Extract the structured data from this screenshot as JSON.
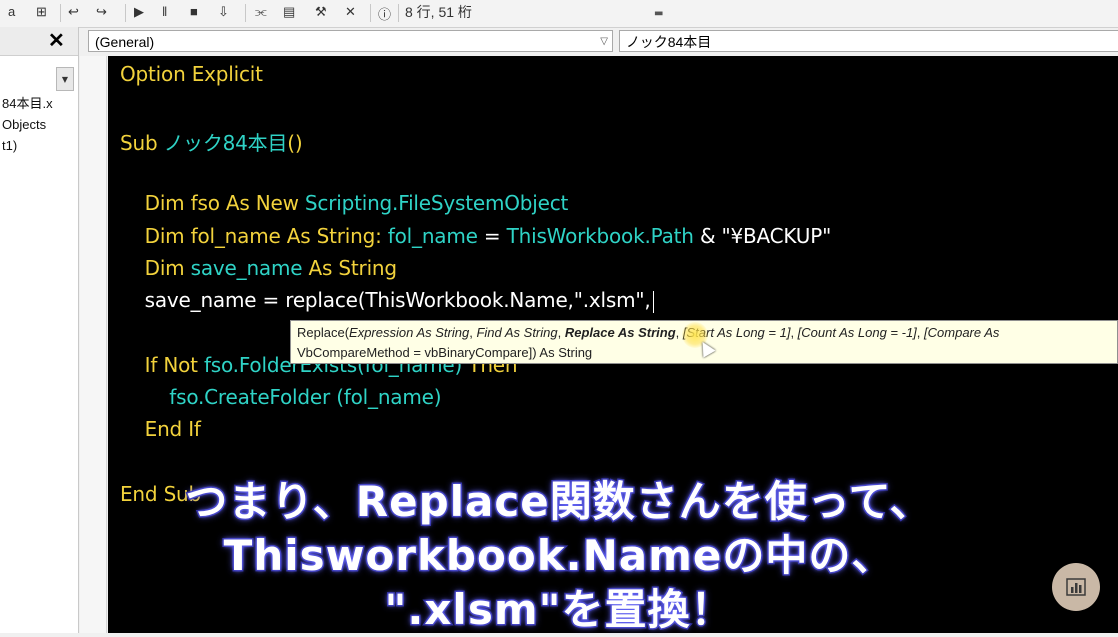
{
  "toolbar": {
    "items": [
      "a",
      "⊞",
      "↩",
      "↪",
      "▶",
      "‖",
      "■",
      "⇩",
      "⫘",
      "▤",
      "⚒",
      "✕",
      "ⓘ"
    ],
    "status": "8 行, 51 桁"
  },
  "project_panel": {
    "close_label": "✕",
    "tree": [
      "84本目.x",
      "Objects",
      "t1)"
    ]
  },
  "combos": {
    "object": "(General)",
    "procedure": "ノック84本目"
  },
  "code_lines": [
    {
      "tokens": [
        {
          "t": "Option Explicit",
          "c": "kw"
        }
      ]
    },
    {
      "tokens": []
    },
    {
      "tokens": [
        {
          "t": "Sub ",
          "c": "kw"
        },
        {
          "t": "ノック84本目",
          "c": "id"
        },
        {
          "t": "()",
          "c": "kw"
        }
      ]
    },
    {
      "tokens": []
    },
    {
      "tokens": [
        {
          "t": "    Dim fso As New ",
          "c": "kw"
        },
        {
          "t": "Scripting.FileSystemObject",
          "c": "id"
        }
      ]
    },
    {
      "tokens": [
        {
          "t": "    Dim fol_name As String: ",
          "c": "kw"
        },
        {
          "t": "fol_name",
          "c": "id"
        },
        {
          "t": " = ",
          "c": "tx"
        },
        {
          "t": "ThisWorkbook.Path",
          "c": "id"
        },
        {
          "t": " & \"¥BACKUP\"",
          "c": "tx"
        }
      ]
    },
    {
      "tokens": [
        {
          "t": "    Dim ",
          "c": "kw"
        },
        {
          "t": "save_name",
          "c": "id"
        },
        {
          "t": " As String",
          "c": "kw"
        }
      ]
    },
    {
      "tokens": [
        {
          "t": "    save_name = replace(ThisWorkbook.Name,\".xlsm\",",
          "c": "tx"
        }
      ],
      "cursor": true
    },
    {
      "tokens": []
    },
    {
      "tokens": [
        {
          "t": "    If Not ",
          "c": "kw"
        },
        {
          "t": "fso.FolderExists",
          "c": "id"
        },
        {
          "t": "(fol_name) ",
          "c": "id"
        },
        {
          "t": "Then",
          "c": "kw"
        }
      ]
    },
    {
      "tokens": [
        {
          "t": "        fso.CreateFolder ",
          "c": "id"
        },
        {
          "t": "(fol_name)",
          "c": "id"
        }
      ]
    },
    {
      "tokens": [
        {
          "t": "    End If",
          "c": "kw"
        }
      ]
    },
    {
      "tokens": []
    },
    {
      "tokens": [
        {
          "t": "End Sub",
          "c": "kw"
        }
      ]
    }
  ],
  "tooltip": {
    "fn": "Replace(",
    "p1": "Expression As String",
    "p2": "Find As String",
    "p3": "Replace As String",
    "p4": "[Start As Long = 1]",
    "p5": "[Count As Long = -1]",
    "p6": "[Compare As",
    "line2": "VbCompareMethod = vbBinaryCompare]) As String"
  },
  "caption": {
    "line1": "つまり、Replace関数さんを使って、",
    "line2": "Thisworkbook.Nameの中の、",
    "line3": "\".xlsm\"を置換！"
  },
  "colors": {
    "keyword": "#f2d23c",
    "identifier": "#2fd3c6",
    "plain": "#ffffff",
    "editor_bg": "#000000",
    "caption_outline": "#2a2a96"
  },
  "icons": {
    "corner": "bar-chart-icon"
  }
}
